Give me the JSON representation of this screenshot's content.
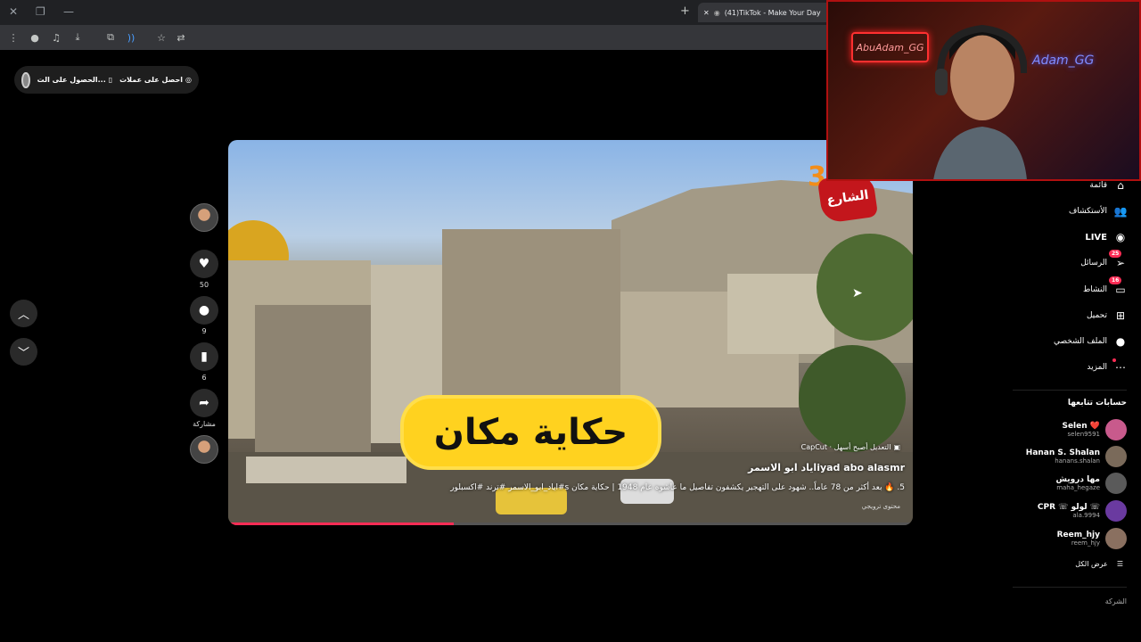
{
  "browser": {
    "tab_title": "(41)TikTok - Make Your Day",
    "new_tab_symbol": "+",
    "close_symbol": "✕"
  },
  "topbar": {
    "get_coins": "احصل على عملات",
    "get_app": "الحصول على الت..."
  },
  "video": {
    "headline": "حكاية  مكان",
    "logo_text": "الشارع",
    "logo_number": "3",
    "capcut_label": "CapCut · التعديل أصبح أسهل",
    "author": "اياد ابو الاسمرiyad abo alasmr",
    "description": "5. 🔥 بعد أكثر من 78 عاماً.. شهود على التهجير يكشفون تفاصيل ما عاشوه عام 1948 | حكاية مكان s#اياد_ابو_الاسمر #ترند #اكسبلور",
    "ai_label": "محتوى ترويجي",
    "progress": 0.33
  },
  "actions": {
    "likes": "50",
    "comments": "9",
    "saves": "6",
    "share": "مشاركة"
  },
  "webcam": {
    "neon_left": "AbuAdam_GG",
    "neon_right": "Adam_GG"
  },
  "sidebar": {
    "items": [
      {
        "label": "قائمة",
        "icon": "feed-icon"
      },
      {
        "label": "الأستكشاف",
        "icon": "friends-icon"
      },
      {
        "label": "LIVE",
        "icon": "live-icon"
      },
      {
        "label": "الرسائل",
        "icon": "messages-icon",
        "badge": "25"
      },
      {
        "label": "النشاط",
        "icon": "activity-icon",
        "badge": "16"
      },
      {
        "label": "تحميل",
        "icon": "upload-icon"
      },
      {
        "label": "الملف الشخصي",
        "icon": "profile-icon"
      },
      {
        "label": "المزيد",
        "icon": "more-icon"
      }
    ],
    "following_title": "حسابات تتابعها",
    "accounts": [
      {
        "name": "Selen ❤️",
        "handle": "selen9591",
        "color": "#c85a8c"
      },
      {
        "name": "Hanan S. Shalan",
        "handle": "hanans.shalan",
        "color": "#7a6a5a"
      },
      {
        "name": "مها درويش",
        "handle": "maha_hegaze",
        "color": "#5a5a5a"
      },
      {
        "name": "CPR ☏ لولو ☏",
        "handle": "ala.9994",
        "color": "#6a3aa0"
      },
      {
        "name": "Reem_hjy",
        "handle": "reem_hjy",
        "color": "#8a7060"
      }
    ],
    "see_all": "عرض الكل",
    "company": "الشركة"
  }
}
